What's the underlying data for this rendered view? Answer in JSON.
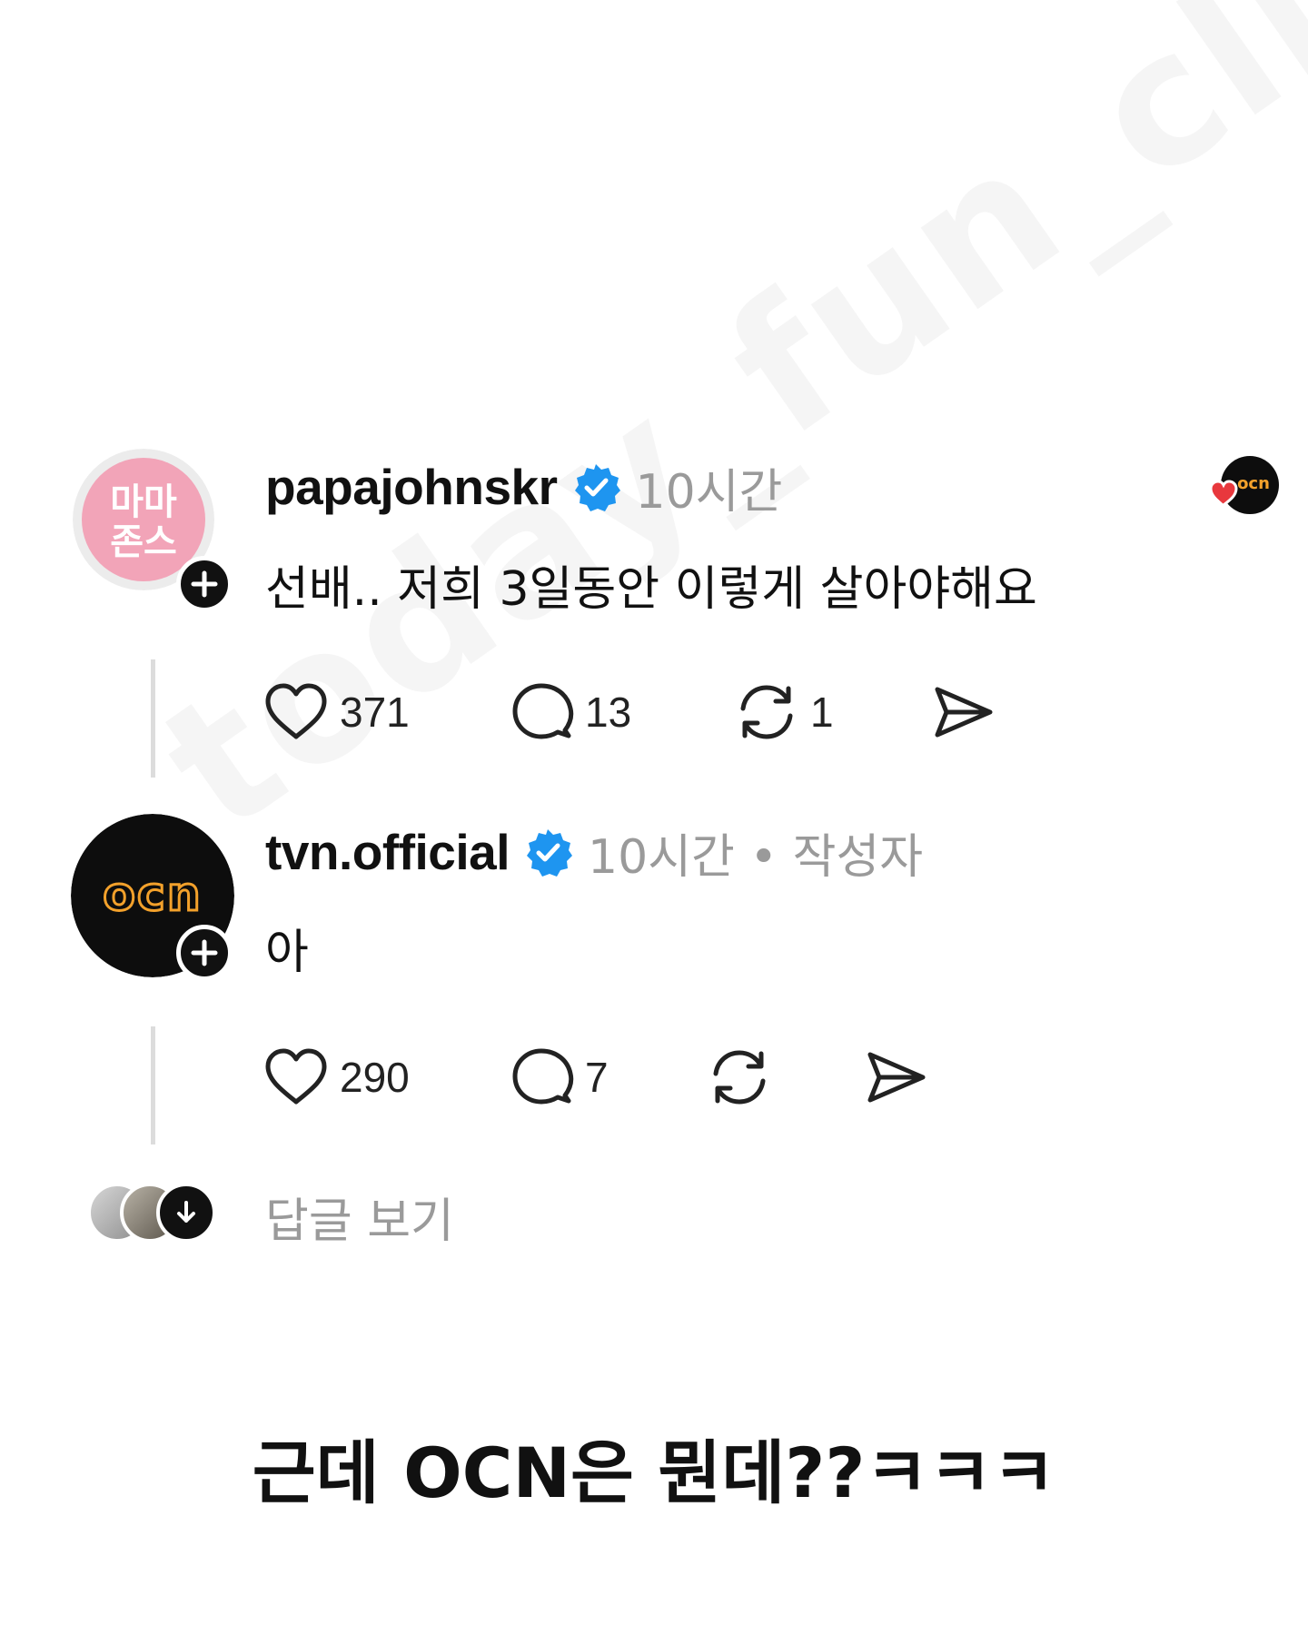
{
  "posts": [
    {
      "username": "papajohnskr",
      "timestamp": "10시간",
      "author_tag": "",
      "text": "선배.. 저희 3일동안 이렇게 살아야해요",
      "avatar_text": [
        "마마",
        "존스"
      ],
      "avatar_colors": {
        "background": "#f2a4b8",
        "text": "#ffffff"
      },
      "actions": {
        "likes": "371",
        "comments": "13",
        "reposts": "1"
      },
      "icons": [
        "heart-icon",
        "comment-icon",
        "repost-icon",
        "share-icon",
        "plus-icon",
        "verified-badge-icon"
      ]
    },
    {
      "username": "tvn.official",
      "timestamp": "10시간 • 작성자",
      "text": "아",
      "avatar_text": [
        "ocn"
      ],
      "avatar_colors": {
        "background": "#0d0d0d",
        "logo": "#f3a12b"
      },
      "actions": {
        "likes": "290",
        "comments": "7",
        "reposts": ""
      },
      "icons": [
        "heart-icon",
        "comment-icon",
        "repost-icon",
        "share-icon",
        "plus-icon",
        "verified-badge-icon"
      ]
    }
  ],
  "liked_by_avatar": {
    "logo_text": "ocn",
    "heart_color": "#e8383d"
  },
  "view_replies_label": "답글 보기",
  "watermark": "today_fun_clip",
  "caption": "근데 OCN은 뭔데??ㅋㅋㅋ",
  "colors": {
    "verified": "#1e95f0",
    "muted_text": "#9a9a9a",
    "text": "#111111",
    "ocn_orange": "#f3a12b"
  }
}
